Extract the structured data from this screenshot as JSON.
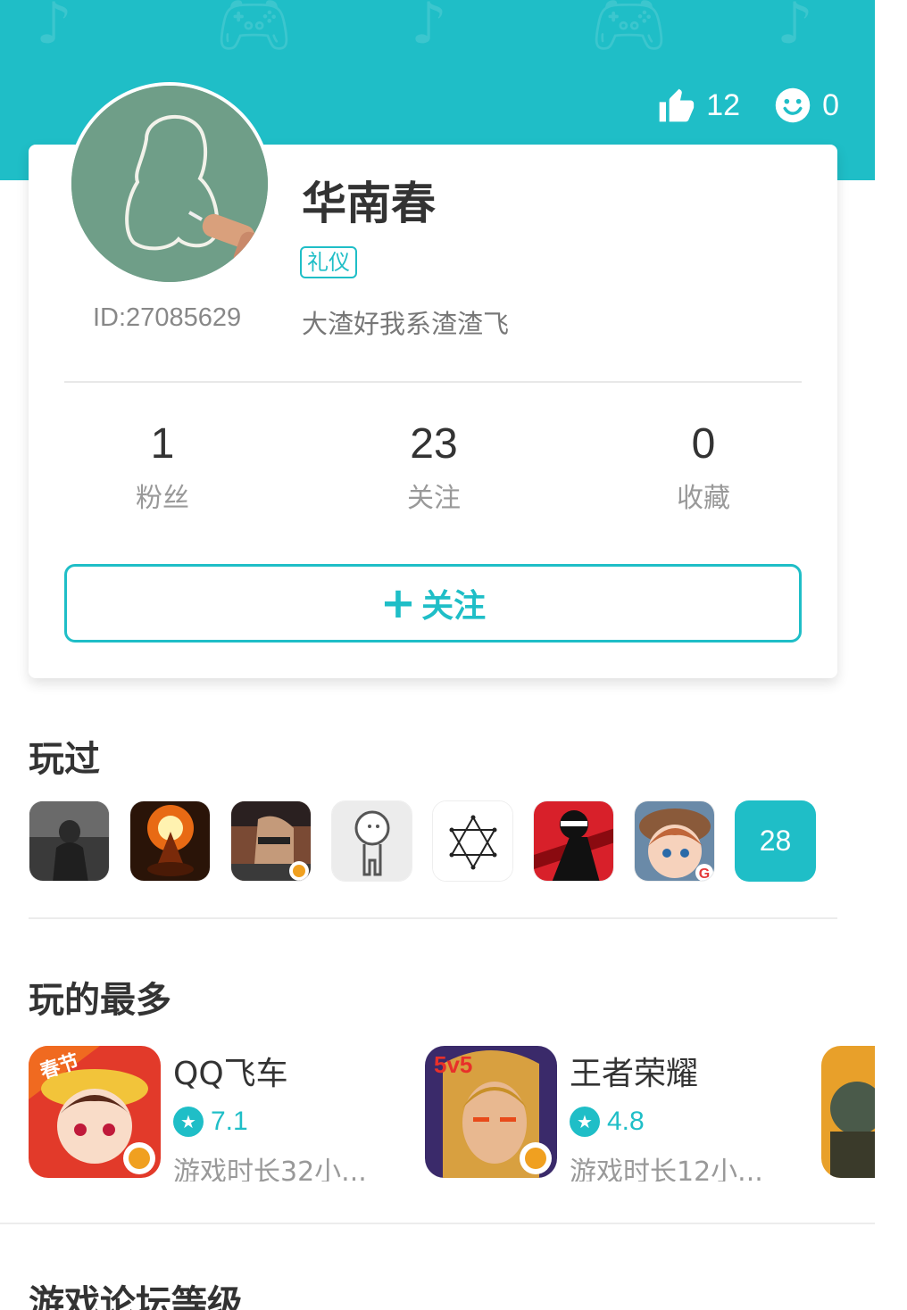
{
  "header": {
    "likes_count": "12",
    "smiles_count": "0",
    "background_color": "#1fbec7"
  },
  "profile": {
    "name": "华南春",
    "tag": "礼仪",
    "id_text": "ID:27085629",
    "signature": "大渣好我系渣渣飞"
  },
  "stats": [
    {
      "value": "1",
      "label": "粉丝"
    },
    {
      "value": "23",
      "label": "关注"
    },
    {
      "value": "0",
      "label": "收藏"
    }
  ],
  "follow_button": {
    "label": "关注"
  },
  "played": {
    "title": "玩过",
    "games": [
      {
        "icon": "soldier-game-icon"
      },
      {
        "icon": "meditating-monk-game-icon"
      },
      {
        "icon": "shooter-game-icon"
      },
      {
        "icon": "stick-figure-game-icon"
      },
      {
        "icon": "hexagram-game-icon"
      },
      {
        "icon": "ninja-game-icon"
      },
      {
        "icon": "chibi-girl-game-icon"
      }
    ],
    "more_count": "28"
  },
  "most_played": {
    "title": "玩的最多",
    "games": [
      {
        "name": "QQ飞车",
        "rating": "7.1",
        "playtime": "游戏时长32小..."
      },
      {
        "name": "王者荣耀",
        "rating": "4.8",
        "playtime": "游戏时长12小..."
      }
    ]
  },
  "forum_level": {
    "title": "游戏论坛等级"
  },
  "accent_color": "#1fbec7"
}
